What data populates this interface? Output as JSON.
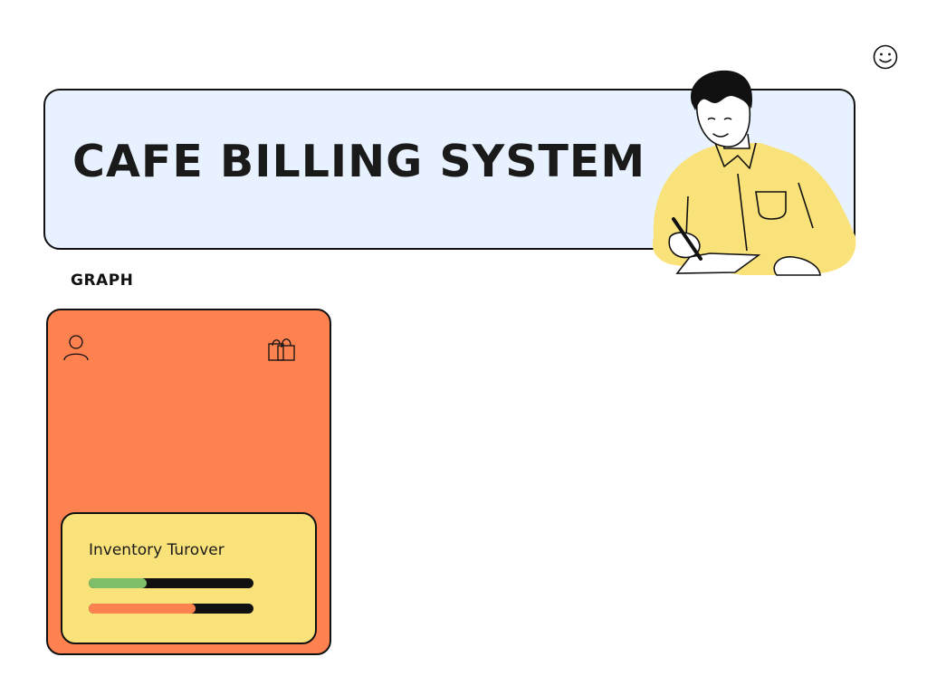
{
  "header": {
    "title": "CAFE BILLING SYSTEM",
    "smiley_icon": "smiley-face-icon"
  },
  "section": {
    "label": "GRAPH"
  },
  "card": {
    "icons": [
      "user-icon",
      "shopping-bag-icon"
    ],
    "background_color": "#fe8150",
    "panel": {
      "title": "Inventory Turover",
      "progress": [
        {
          "fraction": 0.35,
          "color": "#7fbf6a"
        },
        {
          "fraction": 0.65,
          "color": "#fe8150"
        }
      ]
    }
  },
  "colors": {
    "banner_bg": "#e8f1ff",
    "panel_bg": "#fae27a",
    "shirt": "#f9e27a"
  }
}
